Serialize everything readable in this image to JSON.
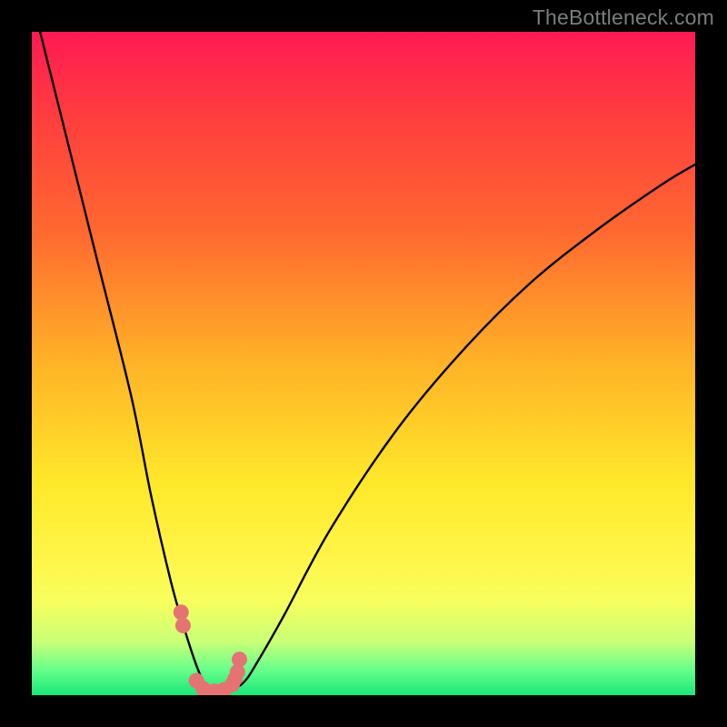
{
  "watermark": "TheBottleneck.com",
  "chart_data": {
    "type": "line",
    "title": "",
    "xlabel": "",
    "ylabel": "",
    "xlim": [
      0,
      100
    ],
    "ylim": [
      0,
      100
    ],
    "series": [
      {
        "name": "bottleneck-curve",
        "x": [
          0,
          5,
          10,
          15,
          18,
          21,
          23,
          25,
          26.5,
          28,
          30,
          32,
          34,
          38,
          45,
          55,
          65,
          75,
          85,
          95,
          100
        ],
        "values": [
          105,
          85,
          65,
          45,
          30,
          17,
          10,
          4,
          1,
          0.5,
          0.8,
          2,
          5,
          12,
          25,
          40,
          52,
          62,
          70,
          77,
          80
        ]
      }
    ],
    "markers": {
      "name": "highlight-dots",
      "color": "#e57373",
      "x": [
        22.5,
        22.8,
        24.8,
        25.8,
        27.5,
        29.0,
        30.2,
        30.6,
        31.0,
        31.3
      ],
      "values": [
        12.5,
        10.5,
        2.2,
        1.0,
        0.6,
        0.8,
        1.6,
        2.4,
        3.5,
        5.4
      ]
    },
    "gradient_bands": [
      {
        "stop": 0.0,
        "color": "#ff1a53"
      },
      {
        "stop": 0.5,
        "color": "#ffe82a"
      },
      {
        "stop": 0.92,
        "color": "#c8ff77"
      },
      {
        "stop": 1.0,
        "color": "#18e87a"
      }
    ]
  }
}
